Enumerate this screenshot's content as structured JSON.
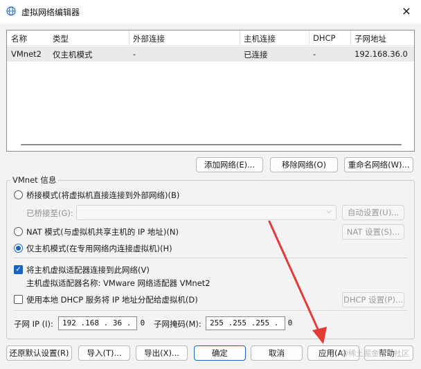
{
  "window": {
    "title": "虚拟网络编辑器",
    "close_glyph": "✕"
  },
  "network_table": {
    "columns": [
      "名称",
      "类型",
      "外部连接",
      "主机连接",
      "DHCP",
      "子网地址"
    ],
    "rows": [
      [
        "VMnet2",
        "仅主机模式",
        "-",
        "已连接",
        "-",
        "192.168.36.0"
      ]
    ]
  },
  "list_buttons": {
    "add": "添加网络(E)...",
    "remove": "移除网络(O)",
    "rename": "重命名网络(W)..."
  },
  "vmnet_info": {
    "group_title": "VMnet 信息",
    "bridged_label": "桥接模式(将虚拟机直接连接到外部网络)(B)",
    "bridged_to_label": "已桥接至(G):",
    "auto_settings": "自动设置(U)...",
    "nat_label": "NAT 模式(与虚拟机共享主机的 IP 地址)(N)",
    "nat_settings": "NAT 设置(S)...",
    "host_only_label": "仅主机模式(在专用网络内连接虚拟机)(H)",
    "connect_adapter_label": "将主机虚拟适配器连接到此网络(V)",
    "adapter_name_label": "主机虚拟适配器名称: VMware 网络适配器 VMnet2",
    "dhcp_label": "使用本地 DHCP 服务将 IP 地址分配给虚拟机(D)",
    "dhcp_settings": "DHCP 设置(P)...",
    "subnet_ip_label": "子网 IP (I):",
    "subnet_ip_value": "192 .168 . 36 .  0",
    "subnet_mask_label": "子网掩码(M):",
    "subnet_mask_value": "255 .255 .255 .  0",
    "selected_mode": "host-only",
    "connect_adapter_checked": true,
    "dhcp_checked": false
  },
  "footer_buttons": {
    "restore": "还原默认设置(R)",
    "import": "导入(T)...",
    "export": "导出(X)...",
    "ok": "确定",
    "cancel": "取消",
    "apply": "应用(A)",
    "help": "帮助"
  },
  "watermark": "@稀土掘金技术社区",
  "colors": {
    "accent": "#1a63c4",
    "annotation_arrow": "#e53935"
  },
  "icons": {
    "title": "network-globe-icon",
    "close": "close-icon",
    "dropdown": "chevron-down-icon"
  }
}
